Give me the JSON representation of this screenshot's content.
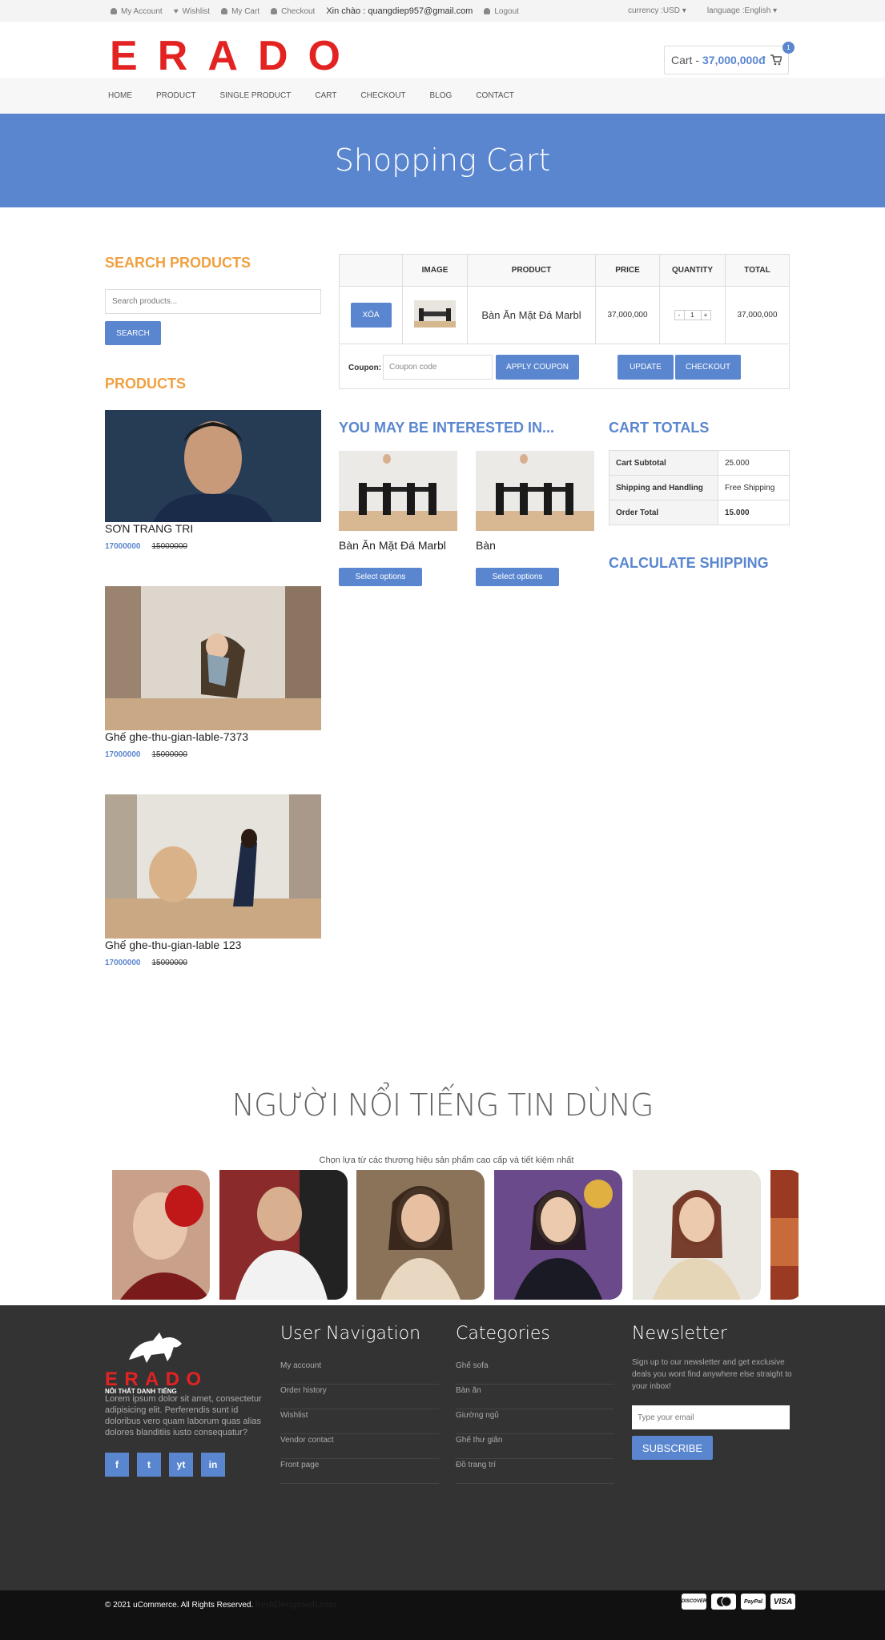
{
  "topbar": {
    "my_account": "My Account",
    "wishlist": "Wishlist",
    "my_cart": "My Cart",
    "checkout": "Checkout",
    "hello": "Xin chào : quangdiep957@gmail.com",
    "logout": "Logout",
    "currency": "currency :USD",
    "language": "language :English"
  },
  "header": {
    "logo_text": "ERADO",
    "cart_label": "Cart -",
    "cart_total": "37,000,000đ",
    "cart_count": "1"
  },
  "nav": {
    "items": [
      "HOME",
      "PRODUCT",
      "SINGLE PRODUCT",
      "CART",
      "CHECKOUT",
      "BLOG",
      "CONTACT"
    ]
  },
  "banner": {
    "title": "Shopping Cart"
  },
  "sidebar": {
    "search_heading": "SEARCH PRODUCTS",
    "search_placeholder": "Search products...",
    "search_button": "SEARCH",
    "products_heading": "PRODUCTS",
    "products": [
      {
        "title": "SƠN TRANG TRI",
        "price": "17000000",
        "old_price": "15000000"
      },
      {
        "title": "Ghế ghe-thu-gian-lable-7373",
        "price": "17000000",
        "old_price": "15000000"
      },
      {
        "title": "Ghế ghe-thu-gian-lable 123",
        "price": "17000000",
        "old_price": "15000000"
      }
    ]
  },
  "cart": {
    "headers": [
      "",
      "IMAGE",
      "PRODUCT",
      "PRICE",
      "QUANTITY",
      "TOTAL"
    ],
    "row": {
      "remove": "XÓA",
      "product": "Bàn Ăn Mặt Đá Marbl",
      "price": "37,000,000",
      "qty_minus": "-",
      "qty": "1",
      "qty_plus": "+",
      "total": "37,000,000"
    },
    "coupon_label": "Coupon:",
    "coupon_placeholder": "Coupon code",
    "apply_coupon": "APPLY COUPON",
    "update": "UPDATE",
    "checkout": "CHECKOUT"
  },
  "interested": {
    "heading": "YOU MAY BE INTERESTED IN...",
    "items": [
      {
        "title": "Bàn Ăn Mặt Đá Marbl",
        "button": "Select options"
      },
      {
        "title": "Bàn",
        "button": "Select options"
      }
    ]
  },
  "totals": {
    "heading": "CART TOTALS",
    "rows": [
      {
        "label": "Cart Subtotal",
        "value": "25.000"
      },
      {
        "label": "Shipping and Handling",
        "value": "Free Shipping"
      },
      {
        "label": "Order Total",
        "value": "15.000"
      }
    ],
    "shipping_heading": "CALCULATE SHIPPING"
  },
  "celebs": {
    "heading": "NGƯỜI NỔI TIẾNG TIN DÙNG",
    "subheading": "Chọn lựa từ các thương hiệu sản phẩm cao cấp và tiết kiệm nhất"
  },
  "footer": {
    "brand": "ERADO",
    "tagline": "NỘI THẤT DANH TIẾNG",
    "description": "Lorem ipsum dolor sit amet, consectetur adipisicing elit. Perferendis sunt id doloribus vero quam laborum quas alias dolores blanditiis iusto consequatur?",
    "social": [
      "f",
      "t",
      "yt",
      "in"
    ],
    "user_nav_heading": "User Navigation",
    "user_nav": [
      "My account",
      "Order history",
      "Wishlist",
      "Vendor contact",
      "Front page"
    ],
    "categories_heading": "Categories",
    "categories": [
      "Ghế sofa",
      "Bàn ăn",
      "Giường ngủ",
      "Ghế thư giãn",
      "Đồ trang trí"
    ],
    "newsletter_heading": "Newsletter",
    "newsletter_text": "Sign up to our newsletter and get exclusive deals you wont find anywhere else straight to your inbox!",
    "newsletter_placeholder": "Type your email",
    "subscribe": "SUBSCRIBE"
  },
  "bottom": {
    "copyright": "© 2021 uCommerce. All Rights Reserved.",
    "watermark": "freshDesignweb.com",
    "payments": [
      "DISCOVER",
      "MC",
      "PayPal",
      "VISA"
    ]
  },
  "colors": {
    "accent": "#5a86cf",
    "orange": "#f0a040",
    "footer": "#333333"
  }
}
